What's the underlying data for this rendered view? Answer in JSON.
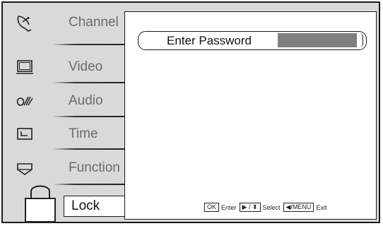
{
  "menu": {
    "items": [
      {
        "label": "Channel",
        "icon": "satellite-dish-icon"
      },
      {
        "label": "Video",
        "icon": "monitor-icon"
      },
      {
        "label": "Audio",
        "icon": "audio-icon"
      },
      {
        "label": "Time",
        "icon": "clock-icon"
      },
      {
        "label": "Function",
        "icon": "function-icon"
      },
      {
        "label": "Lock",
        "icon": "lock-icon"
      }
    ],
    "selected_index": 5
  },
  "password": {
    "label": "Enter Password"
  },
  "hint": {
    "ok_key": "OK",
    "ok_text": "Enter",
    "nav_key": "▶ / ⬍",
    "nav_text": "Select",
    "exit_key": "◀/MENU",
    "exit_text": "Exit"
  }
}
